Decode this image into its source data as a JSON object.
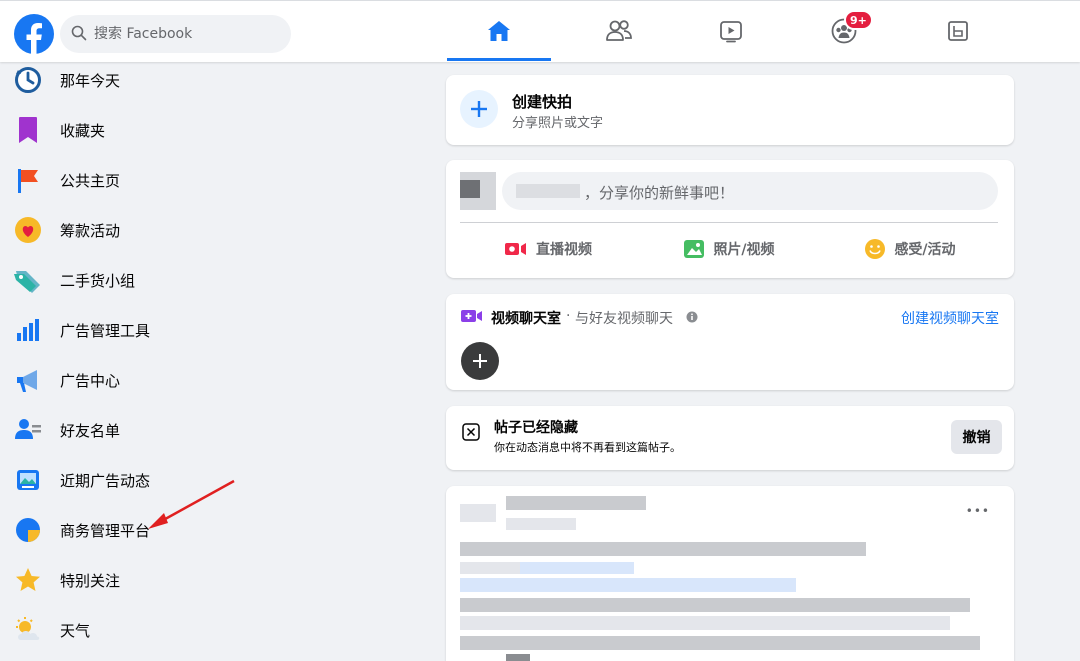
{
  "topbar": {
    "search_placeholder": "搜索 Facebook",
    "groups_badge": "9+"
  },
  "sidebar": {
    "items": [
      {
        "label": "那年今天",
        "icon": "clock-icon"
      },
      {
        "label": "收藏夹",
        "icon": "bookmark-icon"
      },
      {
        "label": "公共主页",
        "icon": "flag-icon"
      },
      {
        "label": "筹款活动",
        "icon": "heart-icon"
      },
      {
        "label": "二手货小组",
        "icon": "tag-icon"
      },
      {
        "label": "广告管理工具",
        "icon": "bar-chart-icon"
      },
      {
        "label": "广告中心",
        "icon": "megaphone-icon"
      },
      {
        "label": "好友名单",
        "icon": "friends-icon"
      },
      {
        "label": "近期广告动态",
        "icon": "ad-activity-icon"
      },
      {
        "label": "商务管理平台",
        "icon": "pie-chart-icon"
      },
      {
        "label": "特别关注",
        "icon": "star-icon"
      },
      {
        "label": "天气",
        "icon": "weather-icon"
      }
    ]
  },
  "story": {
    "title": "创建快拍",
    "subtitle": "分享照片或文字"
  },
  "composer": {
    "placeholder_suffix": "，分享你的新鲜事吧！",
    "actions": [
      {
        "label": "直播视频",
        "color": "#f02849"
      },
      {
        "label": "照片/视频",
        "color": "#45bd62"
      },
      {
        "label": "感受/活动",
        "color": "#f7b928"
      }
    ]
  },
  "rooms": {
    "title": "视频聊天室",
    "separator": "·",
    "subtitle": "与好友视频聊天",
    "create_link": "创建视频聊天室"
  },
  "hidden_post": {
    "title": "帖子已经隐藏",
    "subtitle": "你在动态消息中将不再看到这篇帖子。",
    "undo_label": "撤销"
  },
  "post": {
    "more_label": "•••"
  },
  "colors": {
    "brand": "#1877f2",
    "annotation_arrow": "#e02020"
  }
}
